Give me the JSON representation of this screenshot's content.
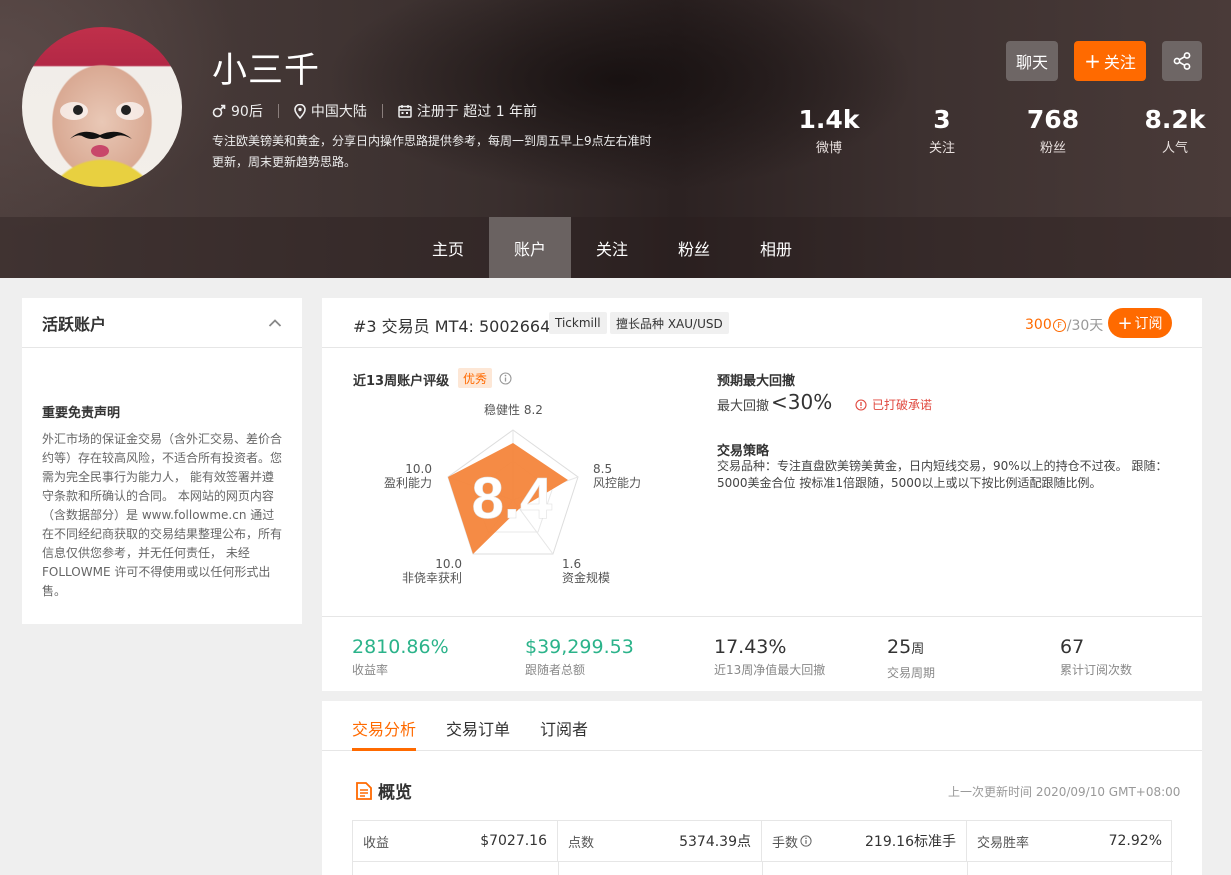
{
  "profile": {
    "name": "小三千",
    "age_group": "90后",
    "location": "中国大陆",
    "registered": "注册于 超过 1 年前",
    "bio": "专注欧美镑美和黄金，分享日内操作思路提供参考，每周一到周五早上9点左右准时更新，周末更新趋势思路。"
  },
  "actions": {
    "chat": "聊天",
    "follow": "关注"
  },
  "stats": [
    {
      "value": "1.4k",
      "label": "微博"
    },
    {
      "value": "3",
      "label": "关注"
    },
    {
      "value": "768",
      "label": "粉丝"
    },
    {
      "value": "8.2k",
      "label": "人气"
    }
  ],
  "nav": [
    "主页",
    "账户",
    "关注",
    "粉丝",
    "相册"
  ],
  "nav_active": 1,
  "sidebar": {
    "title": "活跃账户",
    "disclaimer_title": "重要免责声明",
    "disclaimer_text": "外汇市场的保证金交易（含外汇交易、差价合约等）存在较高风险，不适合所有投资者。您需为完全民事行为能力人， 能有效签署并遵守条款和所确认的合同。 本网站的网页内容（含数据部分）是 www.followme.cn 通过在不同经纪商获取的交易结果整理公布，所有信息仅供您参考，并无任何责任， 未经 FOLLOWME 许可不得使用或以任何形式出售。"
  },
  "trader": {
    "header": "#3 交易员 MT4: 5002664",
    "broker_tag": "Tickmill",
    "skill_tag": "擅长品种 XAU/USD",
    "price": "300",
    "coin_glyph": "₣",
    "period": "/30天",
    "subscribe": "订阅"
  },
  "rating": {
    "title": "近13周账户评级",
    "badge": "优秀",
    "score": "8.4",
    "axes": [
      {
        "name": "稳健性",
        "value": "8.2"
      },
      {
        "name": "风控能力",
        "value": "8.5"
      },
      {
        "name": "资金规模",
        "value": "1.6"
      },
      {
        "name": "非侥幸获利",
        "value": "10.0"
      },
      {
        "name": "盈利能力",
        "value": "10.0"
      }
    ]
  },
  "drawdown": {
    "title": "预期最大回撤",
    "label": "最大回撤",
    "value": "<30%",
    "warning": "已打破承诺"
  },
  "strategy": {
    "title": "交易策略",
    "text": "交易品种：专注直盘欧美镑美黄金，日内短线交易，90%以上的持仓不过夜。 跟随：5000美金合位 按标准1倍跟随，5000以上或以下按比例适配跟随比例。"
  },
  "kpis": [
    {
      "value": "2810.86%",
      "label": "收益率"
    },
    {
      "value": "$39,299.53",
      "label": "跟随者总额"
    },
    {
      "value": "17.43%",
      "label": "近13周净值最大回撤"
    },
    {
      "value": "25",
      "unit": "周",
      "label": "交易周期"
    },
    {
      "value": "67",
      "label": "累计订阅次数"
    }
  ],
  "tabs": [
    "交易分析",
    "交易订单",
    "订阅者"
  ],
  "overview": {
    "title": "概览",
    "updated": "上一次更新时间 2020/09/10 GMT+08:00",
    "cells": [
      {
        "label": "收益",
        "value": "$7027.16"
      },
      {
        "label": "点数",
        "value": "5374.39点"
      },
      {
        "label": "手数",
        "value": "219.16标准手"
      },
      {
        "label": "交易胜率",
        "value": "72.92%"
      }
    ]
  },
  "colors": {
    "accent": "#ff6a00",
    "green": "#2bb38a",
    "radar_fill": "#f4853b"
  }
}
